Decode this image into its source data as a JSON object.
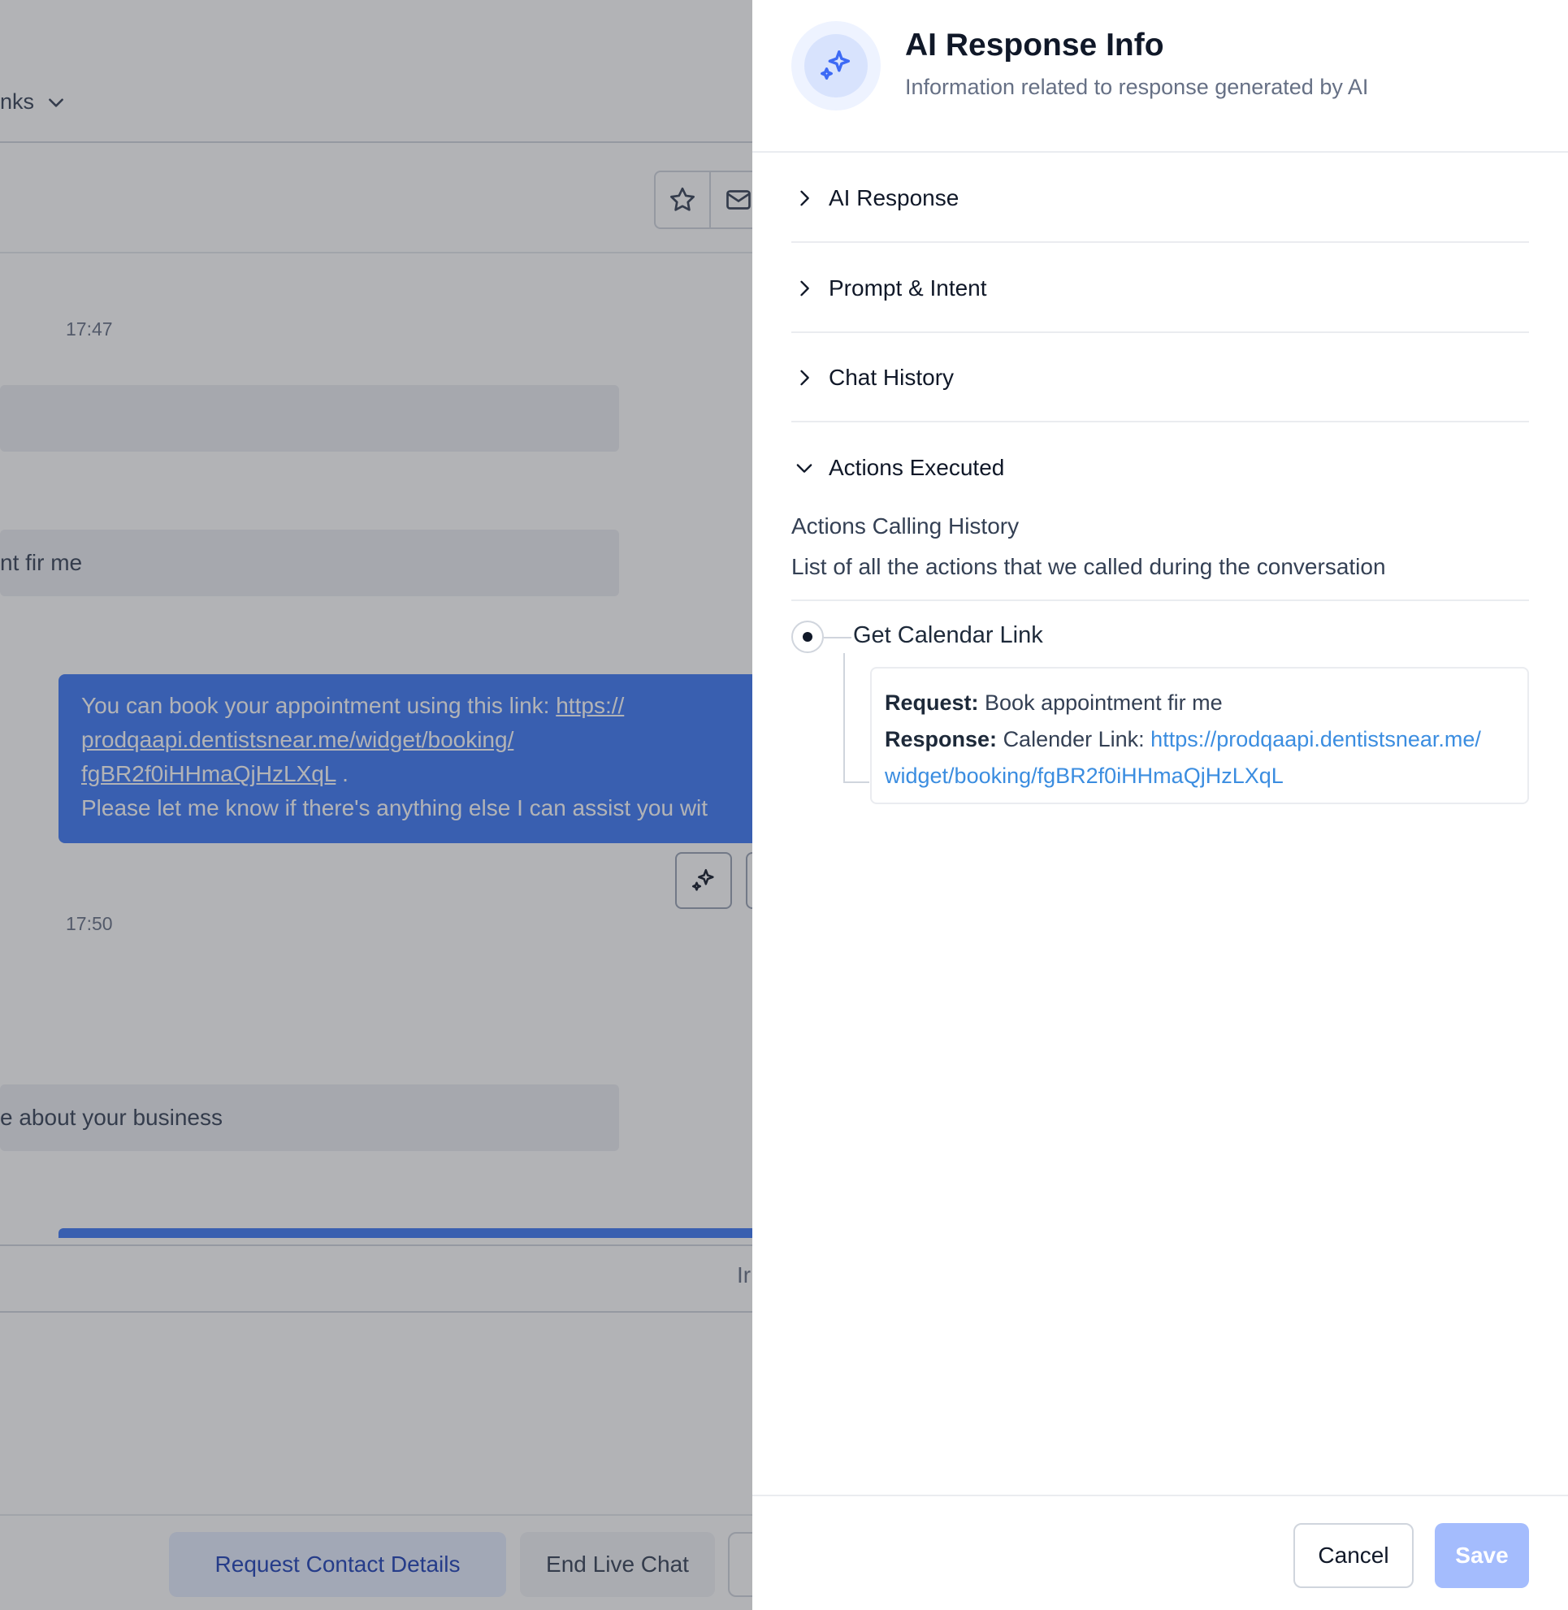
{
  "background": {
    "links_dropdown_label": "nks",
    "timestamps": [
      "17:47",
      "17:50"
    ],
    "incoming_messages": [
      "",
      "nt fir me",
      "e about your business"
    ],
    "outgoing_message": {
      "prefix": "You can book your appointment using this link: ",
      "link_line1": "https://",
      "link_line2": "prodqaapi.dentistsnear.me/widget/booking/",
      "link_line3": "fgBR2f0iHHmaQjHzLXqL",
      "after_link": " .",
      "line4": "Please let me know if there's anything else I can assist you wit"
    },
    "input_hint": "Ir",
    "footer_buttons": {
      "request_contact": "Request Contact Details",
      "end_chat": "End Live Chat"
    }
  },
  "drawer": {
    "title": "AI Response Info",
    "subtitle": "Information related to response generated by AI",
    "sections": [
      {
        "label": "AI Response",
        "expanded": false
      },
      {
        "label": "Prompt & Intent",
        "expanded": false
      },
      {
        "label": "Chat History",
        "expanded": false
      },
      {
        "label": "Actions Executed",
        "expanded": true
      }
    ],
    "actions": {
      "title": "Actions Calling History",
      "description": "List of all the actions that we called during the conversation",
      "items": [
        {
          "name": "Get Calendar Link",
          "request_label": "Request:",
          "request_value": "Book appointment fir me",
          "response_label": "Response:",
          "response_prefix": "Calender Link: ",
          "response_link_line1": "https://prodqaapi.dentistsnear.me/",
          "response_link_line2": "widget/booking/fgBR2f0iHHmaQjHzLXqL"
        }
      ]
    },
    "footer": {
      "cancel_label": "Cancel",
      "save_label": "Save"
    }
  },
  "colors": {
    "accent": "#3d78f5",
    "save_disabled": "#a4bcfd",
    "link": "#3b8de0"
  }
}
